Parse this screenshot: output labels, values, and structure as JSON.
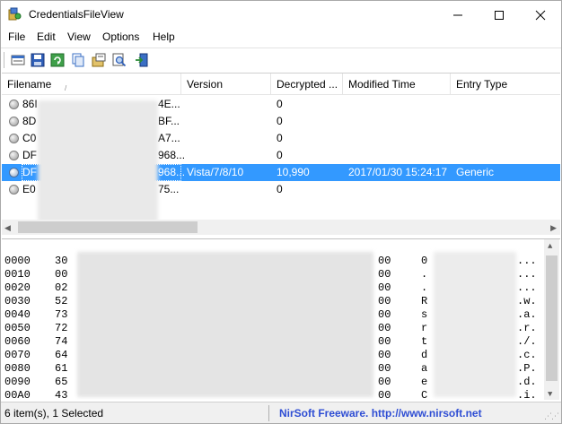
{
  "window": {
    "title": "CredentialsFileView",
    "minimize_glyph": "minimize-icon",
    "maximize_glyph": "maximize-icon",
    "close_glyph": "close-icon"
  },
  "menu": [
    "File",
    "Edit",
    "View",
    "Options",
    "Help"
  ],
  "toolbar": [
    "properties-icon",
    "save-icon",
    "refresh-icon",
    "copy-icon",
    "options-icon",
    "find-icon",
    "exit-icon"
  ],
  "list": {
    "columns": [
      "Filename",
      "Version",
      "Decrypted ...",
      "Modified Time",
      "Entry Type"
    ],
    "sort_indicator": "/",
    "rows": [
      {
        "prefix": "86I",
        "suffix": "4E...",
        "version": "",
        "decrypted": "0",
        "modified": "",
        "type": "",
        "selected": false
      },
      {
        "prefix": "8D",
        "suffix": "BF...",
        "version": "",
        "decrypted": "0",
        "modified": "",
        "type": "",
        "selected": false
      },
      {
        "prefix": "C0",
        "suffix": "A7...",
        "version": "",
        "decrypted": "0",
        "modified": "",
        "type": "",
        "selected": false
      },
      {
        "prefix": "DF",
        "suffix": "968...",
        "version": "",
        "decrypted": "0",
        "modified": "",
        "type": "",
        "selected": false
      },
      {
        "prefix": "DF",
        "suffix": "968...",
        "version": "Vista/7/8/10",
        "decrypted": "10,990",
        "modified": "2017/01/30 15:24:17",
        "type": "Generic",
        "selected": true
      },
      {
        "prefix": "E0",
        "suffix": "75...",
        "version": "",
        "decrypted": "0",
        "modified": "",
        "type": "",
        "selected": false
      }
    ]
  },
  "hex": [
    {
      "off": "0000",
      "b1": "30",
      "last": "00",
      "a1": "0",
      "a2": "..."
    },
    {
      "off": "0010",
      "b1": "00",
      "last": "00",
      "a1": ".",
      "a2": "..."
    },
    {
      "off": "0020",
      "b1": "02",
      "last": "00",
      "a1": ".",
      "a2": "..."
    },
    {
      "off": "0030",
      "b1": "52",
      "last": "00",
      "a1": "R",
      "a2": ".w."
    },
    {
      "off": "0040",
      "b1": "73",
      "last": "00",
      "a1": "s",
      "a2": ".a."
    },
    {
      "off": "0050",
      "b1": "72",
      "last": "00",
      "a1": "r",
      "a2": ".r."
    },
    {
      "off": "0060",
      "b1": "74",
      "last": "00",
      "a1": "t",
      "a2": "./."
    },
    {
      "off": "0070",
      "b1": "64",
      "last": "00",
      "a1": "d",
      "a2": ".c."
    },
    {
      "off": "0080",
      "b1": "61",
      "last": "00",
      "a1": "a",
      "a2": ".P."
    },
    {
      "off": "0090",
      "b1": "65",
      "last": "00",
      "a1": "e",
      "a2": ".d."
    },
    {
      "off": "00A0",
      "b1": "43",
      "last": "00",
      "a1": "C",
      "a2": ".i."
    }
  ],
  "status": {
    "count": "6 item(s), 1 Selected",
    "credit": "NirSoft Freeware.  http://www.nirsoft.net"
  },
  "colors": {
    "selection": "#3399ff",
    "credit_link": "#2f4ed4"
  }
}
